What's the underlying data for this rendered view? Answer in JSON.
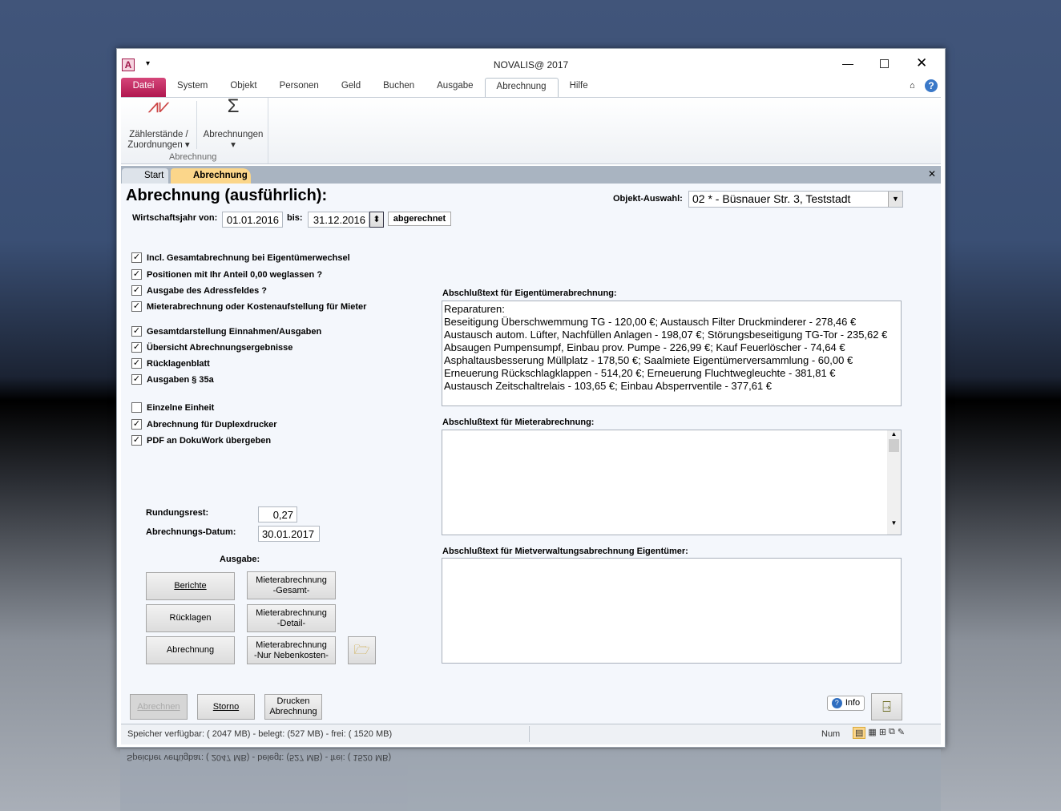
{
  "window": {
    "title": "NOVALIS@ 2017",
    "app_icon": "A"
  },
  "ribbon_tabs": [
    "Datei",
    "System",
    "Objekt",
    "Personen",
    "Geld",
    "Buchen",
    "Ausgabe",
    "Abrechnung",
    "Hilfe"
  ],
  "ribbon": {
    "btn1_line1": "Zählerstände /",
    "btn1_line2": "Zuordnungen",
    "btn2": "Abrechnungen",
    "group": "Abrechnung"
  },
  "doc_tabs": [
    "Start",
    "Abrechnung"
  ],
  "form": {
    "heading": "Abrechnung (ausführlich):",
    "objekt_label": "Objekt-Auswahl:",
    "objekt_value": "02 * - Büsnauer Str. 3, Teststadt",
    "wj_label": "Wirtschaftsjahr von:",
    "wj_from": "01.01.2016",
    "bis_label": "bis:",
    "wj_to": "31.12.2016",
    "abgerechnet": "abgerechnet",
    "checkboxes": [
      {
        "label": "Incl. Gesamtabrechnung bei Eigentümerwechsel",
        "checked": true
      },
      {
        "label": "Positionen mit  Ihr Anteil 0,00 weglassen ?",
        "checked": true
      },
      {
        "label": "Ausgabe des Adressfeldes ?",
        "checked": true
      },
      {
        "label": "Mieterabrechnung oder Kostenaufstellung für Mieter",
        "checked": true
      },
      {
        "label": "Gesamtdarstellung Einnahmen/Ausgaben",
        "checked": true
      },
      {
        "label": "Übersicht Abrechnungsergebnisse",
        "checked": true
      },
      {
        "label": "Rücklagenblatt",
        "checked": true
      },
      {
        "label": "Ausgaben § 35a",
        "checked": true
      },
      {
        "label": "Einzelne Einheit",
        "checked": false
      },
      {
        "label": "Abrechnung für Duplexdrucker",
        "checked": true
      },
      {
        "label": "PDF an DokuWork übergeben",
        "checked": true
      }
    ],
    "rundung_label": "Rundungsrest:",
    "rundung_value": "0,27",
    "datum_label": "Abrechnungs-Datum:",
    "datum_value": "30.01.2017",
    "ausgabe_label": "Ausgabe:",
    "buttons": {
      "berichte": "Berichte",
      "ruecklagen": "Rücklagen",
      "abrechnung": "Abrechnung",
      "mieter_gesamt": "Mieterabrechnung\n-Gesamt-",
      "mieter_detail": "Mieterabrechnung\n-Detail-",
      "mieter_neben": "Mieterabrechnung\n-Nur Nebenkosten-",
      "abrechnen": "Abrechnen",
      "storno": "Storno",
      "drucken": "Drucken\nAbrechnung",
      "info": "Info"
    },
    "eigentuemer_label": "Abschlußtext für Eigentümerabrechnung:",
    "eigentuemer_text": "Reparaturen:\nBeseitigung Überschwemmung TG - 120,00 €; Austausch Filter Druckminderer - 278,46 €\nAustausch autom. Lüfter, Nachfüllen Anlagen - 198,07 €; Störungsbeseitigung TG-Tor - 235,62 €\nAbsaugen Pumpensumpf, Einbau prov. Pumpe - 226,99 €; Kauf Feuerlöscher - 74,64 €\nAsphaltausbesserung Müllplatz - 178,50 €; Saalmiete Eigentümerversammlung - 60,00 €\nErneuerung Rückschlagklappen - 514,20 €; Erneuerung Fluchtwegleuchte - 381,81 €\nAustausch Zeitschaltrelais - 103,65 €; Einbau Absperrventile - 377,61 €",
    "mieter_label": "Abschlußtext für Mieterabrechnung:",
    "mieter_text": "",
    "mietverw_label": "Abschlußtext für Mietverwaltungsabrechnung Eigentümer:",
    "mietverw_text": ""
  },
  "status": {
    "text": "Speicher verfügbar: ( 2047 MB)  -  belegt: (527 MB)  -  frei: ( 1520 MB)",
    "num": "Num"
  }
}
